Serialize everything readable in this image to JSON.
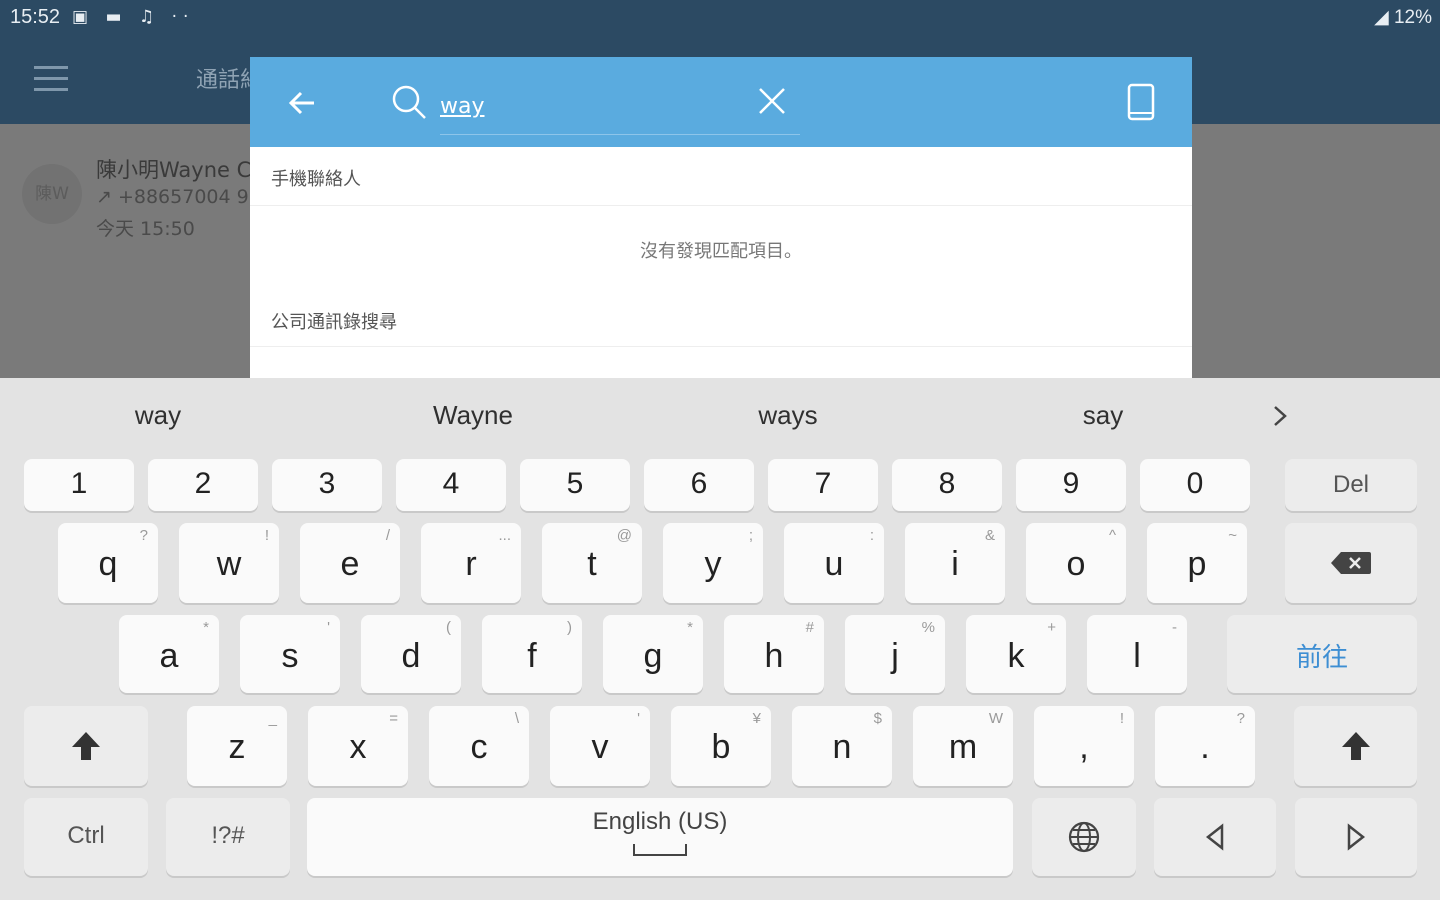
{
  "status_bar": {
    "time": "15:52",
    "left_icons": "▣ ▬ ♫ ··",
    "right_text": "◢ 12%"
  },
  "app_bar": {
    "title": "通話紀"
  },
  "background_list": {
    "avatar_text": "陳W",
    "name": "陳小明Wayne C",
    "phone": "↗ +88657004 9",
    "time": "今天 15:50"
  },
  "search_dialog": {
    "query": "way",
    "section_mobile": "手機聯絡人",
    "no_results": "沒有發現匹配項目。",
    "section_company": "公司通訊錄搜尋",
    "header_color": "#5aabdf"
  },
  "keyboard": {
    "suggestions": [
      "way",
      "Wayne",
      "ways",
      "say"
    ],
    "numbers": [
      "1",
      "2",
      "3",
      "4",
      "5",
      "6",
      "7",
      "8",
      "9",
      "0"
    ],
    "del_label": "Del",
    "row_q": [
      {
        "k": "q",
        "h": "?"
      },
      {
        "k": "w",
        "h": "!"
      },
      {
        "k": "e",
        "h": "/"
      },
      {
        "k": "r",
        "h": "..."
      },
      {
        "k": "t",
        "h": "@"
      },
      {
        "k": "y",
        "h": ";"
      },
      {
        "k": "u",
        "h": ":"
      },
      {
        "k": "i",
        "h": "&"
      },
      {
        "k": "o",
        "h": "^"
      },
      {
        "k": "p",
        "h": "~"
      }
    ],
    "row_a": [
      {
        "k": "a",
        "h": "*"
      },
      {
        "k": "s",
        "h": "'"
      },
      {
        "k": "d",
        "h": "("
      },
      {
        "k": "f",
        "h": ")"
      },
      {
        "k": "g",
        "h": "*"
      },
      {
        "k": "h",
        "h": "#"
      },
      {
        "k": "j",
        "h": "%"
      },
      {
        "k": "k",
        "h": "+"
      },
      {
        "k": "l",
        "h": "-"
      }
    ],
    "go_label": "前往",
    "row_z": [
      {
        "k": "z",
        "h": "_"
      },
      {
        "k": "x",
        "h": "="
      },
      {
        "k": "c",
        "h": "\\"
      },
      {
        "k": "v",
        "h": "'"
      },
      {
        "k": "b",
        "h": "¥"
      },
      {
        "k": "n",
        "h": "$"
      },
      {
        "k": "m",
        "h": "W"
      },
      {
        "k": ",",
        "h": "!"
      },
      {
        "k": ".",
        "h": "?"
      }
    ],
    "ctrl_label": "Ctrl",
    "symbols_label": "!?#",
    "space_label": "English (US)",
    "accent_color": "#3d8ed3"
  }
}
